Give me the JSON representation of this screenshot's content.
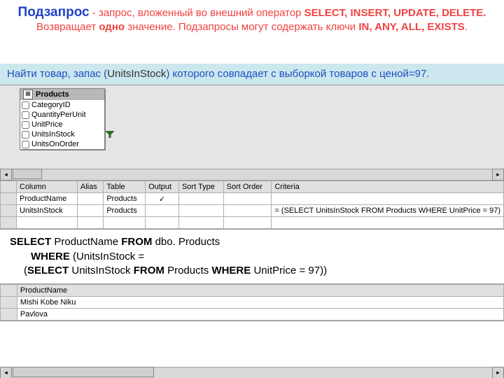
{
  "definition": {
    "term": "Подзапрос",
    "body_a": " - запрос, вложенный во внешний оператор ",
    "kw1": "SELECT, INSERT, UPDATE, DELETE.",
    "body_b": " Возвращает ",
    "kw2": "одно",
    "body_c": " значение. Подзапросы могут содержать ключи ",
    "kw3": "IN, ANY, ALL, EXISTS",
    "period": "."
  },
  "task": {
    "a": "Найти товар, запас (",
    "uis": "UnitsInStock",
    "b": ") которого совпадает с выборкой товаров с ценой=97."
  },
  "tablebox": {
    "title": "Products",
    "cols": [
      "CategoryID",
      "QuantityPerUnit",
      "UnitPrice",
      "UnitsInStock",
      "UnitsOnOrder"
    ]
  },
  "grid": {
    "headers": [
      "Column",
      "Alias",
      "Table",
      "Output",
      "Sort Type",
      "Sort Order",
      "Criteria"
    ],
    "rows": [
      {
        "col": "ProductName",
        "alias": "",
        "table": "Products",
        "output": "✓",
        "sorttype": "",
        "sortorder": "",
        "criteria": ""
      },
      {
        "col": "UnitsInStock",
        "alias": "",
        "table": "Products",
        "output": "",
        "sorttype": "",
        "sortorder": "",
        "criteria": "= (SELECT UnitsInStock FROM Products WHERE UnitPrice = 97)"
      }
    ]
  },
  "sql": {
    "kw_select": "SELECT",
    "l1": "  ProductName ",
    "kw_from": "FROM",
    "l1b": " dbo. Products",
    "kw_where": "WHERE",
    "l2a": "   (UnitsInStock =",
    "l3a": "(",
    "kw_select2": "SELECT",
    "l3b": " UnitsInStock ",
    "kw_from2": "FROM",
    "l3c": " Products ",
    "kw_where2": "WHERE",
    "l3d": " UnitPrice = 97))"
  },
  "results": {
    "header": "ProductName",
    "rows": [
      "Mishi Kobe Niku",
      "Pavlova"
    ]
  }
}
